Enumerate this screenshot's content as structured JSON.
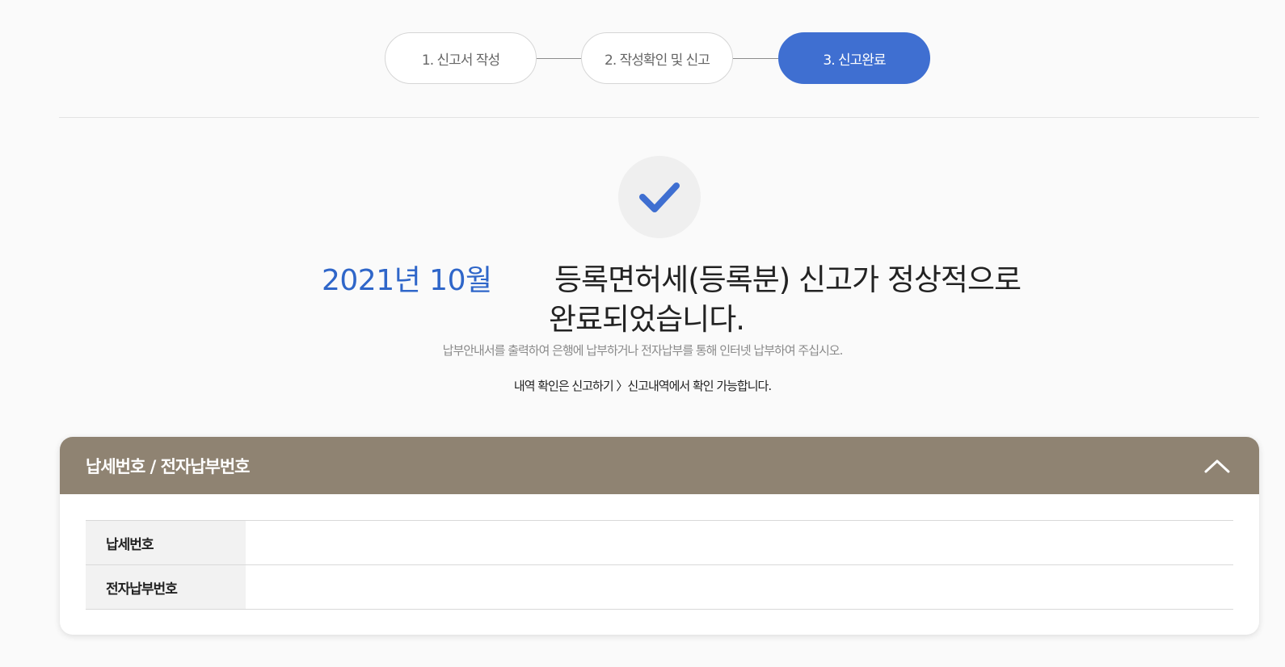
{
  "steps": [
    {
      "label": "1. 신고서 작성",
      "active": false
    },
    {
      "label": "2. 작성확인 및 신고",
      "active": false
    },
    {
      "label": "3. 신고완료",
      "active": true
    }
  ],
  "result": {
    "icon": "check-icon",
    "date": "2021년 10월",
    "message_line1": "등록면허세(등록분) 신고가 정상적으로",
    "message_line2": "완료되었습니다.",
    "guide": "납부안내서를 출력하여 은행에 납부하거나 전자납부를 통해 인터넷 납부하여 주십시오.",
    "info": "내역 확인은 신고하기 〉신고내역에서 확인 가능합니다."
  },
  "panel": {
    "title": "납세번호 / 전자납부번호",
    "toggle_icon": "chevron-up-icon",
    "rows": [
      {
        "label": "납세번호",
        "value": ""
      },
      {
        "label": "전자납부번호",
        "value": ""
      }
    ]
  },
  "colors": {
    "accent": "#3f6fd1",
    "date": "#2f66c9",
    "panel_header": "#8f8372"
  }
}
